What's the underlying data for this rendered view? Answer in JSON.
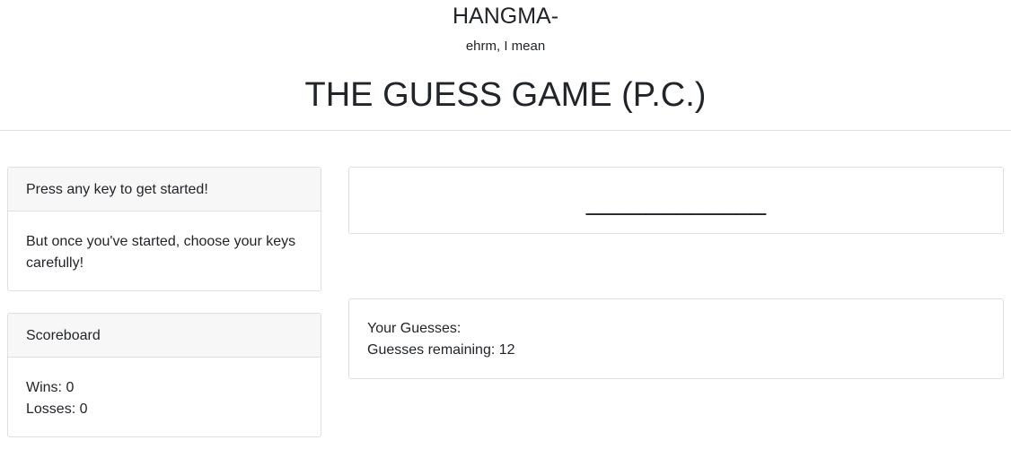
{
  "header": {
    "pre_title": "HANGMA-",
    "aside": "ehrm, I mean",
    "title": "THE GUESS GAME (P.C.)"
  },
  "instructions": {
    "heading": "Press any key to get started!",
    "body_line1": "But once you've started, choose your keys",
    "body_line2": "carefully!"
  },
  "scoreboard": {
    "heading": "Scoreboard",
    "wins": "Wins: 0",
    "losses": "Losses: 0"
  },
  "game": {
    "word_display": "____________"
  },
  "guesses": {
    "your_guesses": "Your Guesses:",
    "remaining": "Guesses remaining: 12"
  }
}
